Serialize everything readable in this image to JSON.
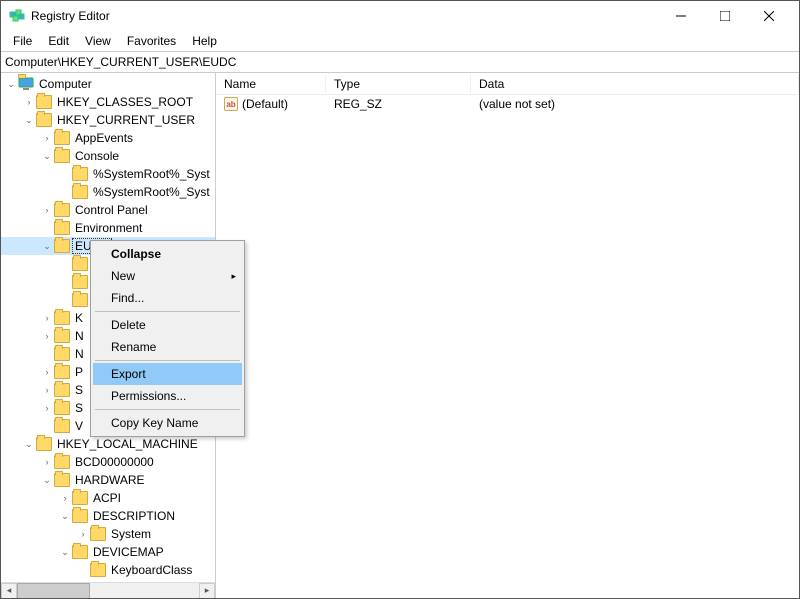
{
  "title": "Registry Editor",
  "menus": {
    "file": "File",
    "edit": "Edit",
    "view": "View",
    "favorites": "Favorites",
    "help": "Help"
  },
  "address": "Computer\\HKEY_CURRENT_USER\\EUDC",
  "tree": {
    "root": "Computer",
    "hkcr": "HKEY_CLASSES_ROOT",
    "hkcu": "HKEY_CURRENT_USER",
    "appevents": "AppEvents",
    "console": "Console",
    "sysroot1": "%SystemRoot%_Syst",
    "sysroot2": "%SystemRoot%_Syst",
    "cpanel": "Control Panel",
    "env": "Environment",
    "eudc": "EUDC",
    "k": "K",
    "n1": "N",
    "n2": "N",
    "p": "P",
    "s1": "S",
    "s2": "S",
    "v": "V",
    "hklm": "HKEY_LOCAL_MACHINE",
    "bcd": "BCD00000000",
    "hardware": "HARDWARE",
    "acpi": "ACPI",
    "description": "DESCRIPTION",
    "system": "System",
    "devicemap": "DEVICEMAP",
    "keyboardclass": "KeyboardClass"
  },
  "columns": {
    "name": "Name",
    "type": "Type",
    "data": "Data"
  },
  "values": [
    {
      "icon": "ab",
      "name": "(Default)",
      "type": "REG_SZ",
      "data": "(value not set)"
    }
  ],
  "context": {
    "collapse": "Collapse",
    "new": "New",
    "find": "Find...",
    "delete": "Delete",
    "rename": "Rename",
    "export": "Export",
    "permissions": "Permissions...",
    "copykey": "Copy Key Name"
  }
}
